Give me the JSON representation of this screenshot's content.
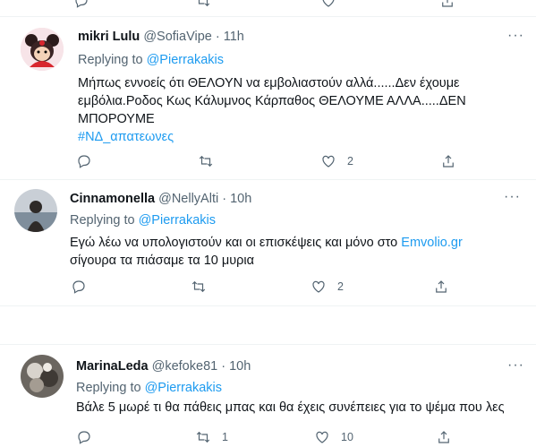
{
  "top_actions": {
    "like_count": "",
    "icons": [
      "reply-icon",
      "retweet-icon",
      "like-icon",
      "share-icon"
    ]
  },
  "tweets": [
    {
      "name": "mikri Lulu",
      "handle": "@SofiaVipe",
      "time": "· 11h",
      "replying_prefix": "Replying to ",
      "replying_to": "@Pierrakakis",
      "text_line1": "Μήπως εννοείς ότι ΘΕΛΟΥΝ να εμβολιαστούν αλλά......Δεν έχουμε",
      "text_line2": "εμβόλια.Ροδος Κως Κάλυμνος Κάρπαθος ΘΕΛΟΥΜΕ ΑΛΛΑ.....ΔΕΝ",
      "text_line3": "ΜΠΟΡΟΥΜΕ",
      "hashtag": "#ΝΔ_απατεωνες",
      "like_count": "2"
    },
    {
      "name": "Cinnamonella",
      "handle": "@NellyAlti",
      "time": "· 10h",
      "replying_prefix": "Replying to ",
      "replying_to": "@Pierrakakis",
      "text_line1_a": "Εγώ λέω να υπολογιστούν και οι επισκέψεις και μόνο στο ",
      "text_line1_link": "Emvolio.gr",
      "text_line2": "σίγουρα τα πιάσαμε τα 10 μυρια",
      "like_count": "2"
    },
    {
      "name": "MarinaLeda",
      "handle": "@kefoke81",
      "time": "· 10h",
      "replying_prefix": "Replying to ",
      "replying_to": "@Pierrakakis",
      "text_line1": "Βάλε 5 μωρέ τι θα πάθεις μπας και θα έχεις συνέπειες για το ψέμα που λες",
      "retweet_count": "1",
      "like_count": "10"
    }
  ],
  "more_label": "···"
}
